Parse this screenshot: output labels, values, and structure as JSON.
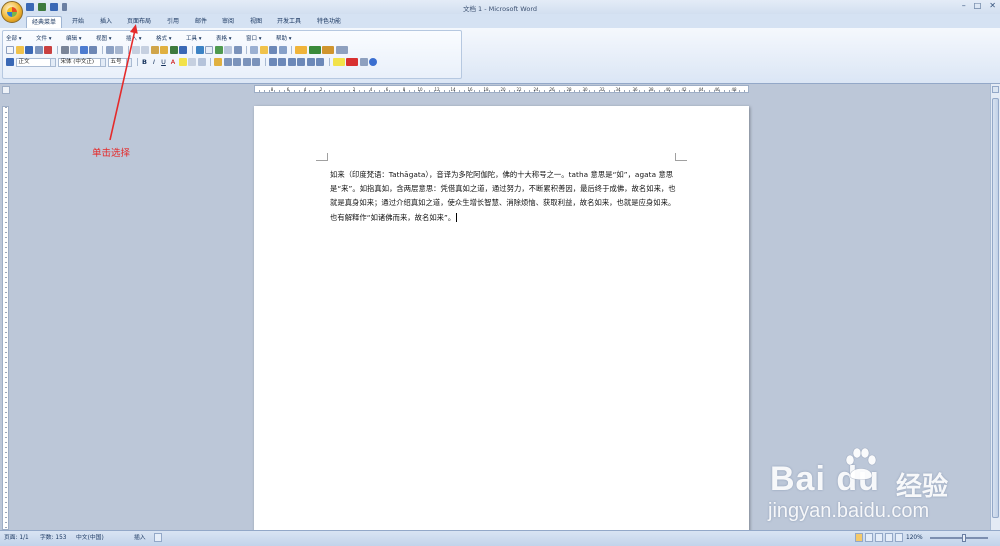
{
  "window": {
    "title": "文档 1 - Microsoft Word",
    "controls": [
      "–",
      "□",
      "✕"
    ]
  },
  "tabs": [
    {
      "label": "经典菜单",
      "active": true
    },
    {
      "label": "开始"
    },
    {
      "label": "插入"
    },
    {
      "label": "页面布局"
    },
    {
      "label": "引用"
    },
    {
      "label": "邮件"
    },
    {
      "label": "审阅"
    },
    {
      "label": "视图"
    },
    {
      "label": "开发工具"
    },
    {
      "label": "特色功能"
    }
  ],
  "menu": [
    "全部 ▾",
    "文件 ▾",
    "编辑 ▾",
    "视图 ▾",
    "插入 ▾",
    "格式 ▾",
    "工具 ▾",
    "表格 ▾",
    "窗口 ▾",
    "帮助 ▾"
  ],
  "format": {
    "style": "正文",
    "font": "宋体 (中文正)",
    "size": "五号",
    "buttons": [
      "B",
      "I",
      "U",
      "A"
    ]
  },
  "ruler": {
    "labels": [
      "8",
      "6",
      "4",
      "2",
      "",
      "2",
      "4",
      "6",
      "8",
      "10",
      "12",
      "14",
      "16",
      "18",
      "20",
      "22",
      "24",
      "26",
      "28",
      "30",
      "32",
      "34",
      "36",
      "38",
      "40",
      "42",
      "44",
      "46",
      "48"
    ]
  },
  "document": {
    "paragraph": "如来（印度梵语：Tathāgata），音译为多陀阿伽陀，佛的十大称号之一。tatha 意思是“如”，agata 意思是“来”。如指真如，含两层意思：凭借真如之道，通过努力，不断累积善因，最后终于成佛，故名如来，也就是真身如来；通过介绍真如之道，使众生增长智慧、消除烦恼、获取利益，故名如来，也就是应身如来。也有解释作“如诸佛而来，故名如来”。"
  },
  "status": {
    "page": "页面: 1/1",
    "words": "字数: 153",
    "language": "中文(中国)",
    "insert": "插入",
    "zoom": "120%"
  },
  "annotation": {
    "text": "单击选择"
  },
  "watermark": {
    "brand": "Bai  du",
    "suffix": "经验",
    "url": "jingyan.baidu.com"
  },
  "colors": {
    "ribbon_blue": "#dbe6f5",
    "annotation_red": "#e52a2a",
    "page_background": "#bcc7d8"
  }
}
